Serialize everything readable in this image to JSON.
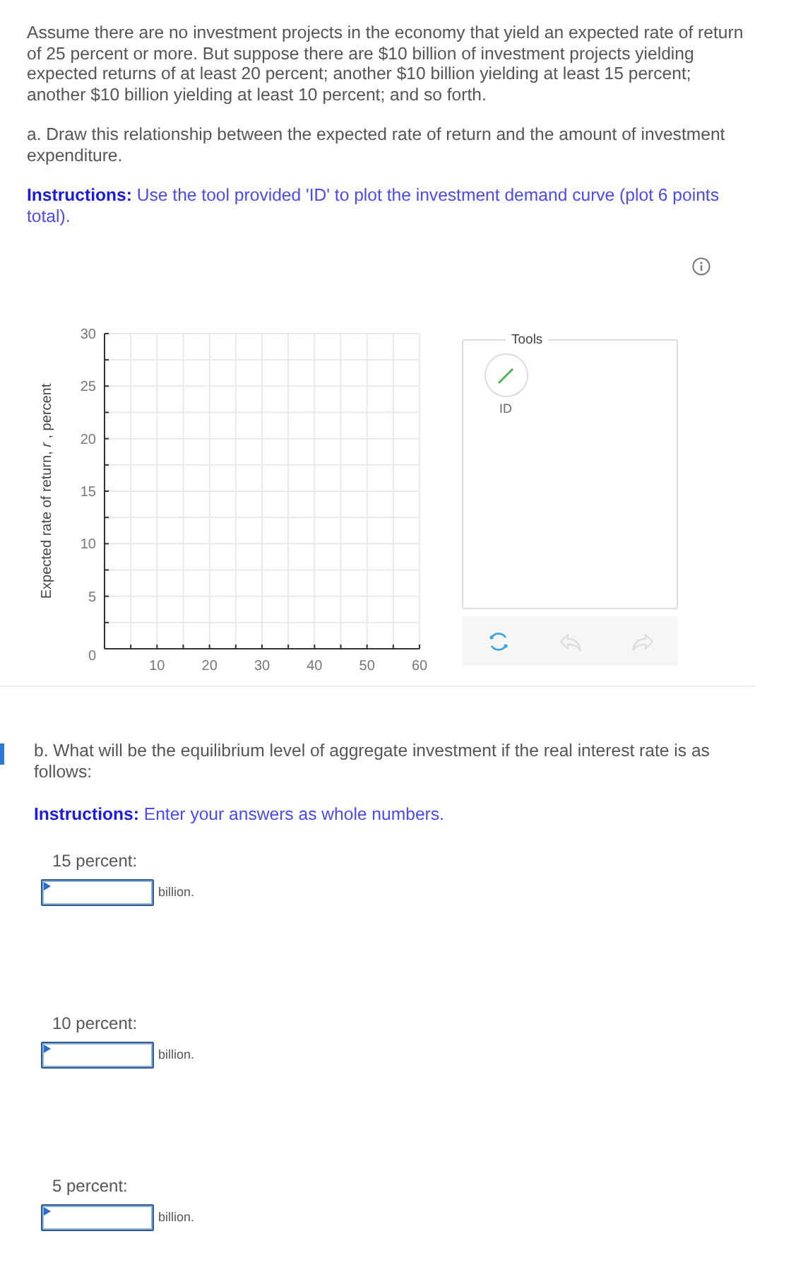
{
  "question": {
    "intro": "Assume there are no investment projects in the economy that yield an expected rate of return of 25 percent or more. But suppose there are $10 billion of investment projects yielding expected returns of at least 20 percent; another $10 billion yielding at least 15 percent; another $10 billion yielding at least 10 percent; and so forth.",
    "part_a": "a. Draw this relationship between the expected rate of return and the amount of investment expenditure.",
    "instructions_a": "**Instructions:** Use the tool provided 'ID' to plot the investment demand curve (plot 6 points total)."
  },
  "graph": {
    "chart_data": {
      "type": "scatter",
      "grid": true,
      "ylabel": "Expected rate of return, *r* , percent",
      "xlim": [
        0,
        60
      ],
      "ylim": [
        0,
        30
      ],
      "xticks": [
        10,
        20,
        30,
        40,
        50,
        60
      ],
      "yticks": [
        0,
        5,
        10,
        15,
        20,
        25,
        30
      ]
    },
    "tools": {
      "title": "Tools",
      "items": [
        {
          "label": "ID",
          "selected": false
        }
      ]
    },
    "toolbar": [
      {
        "kind": "reset",
        "disabled": false
      },
      {
        "kind": "undo",
        "disabled": true
      },
      {
        "kind": "redo",
        "disabled": true
      }
    ]
  },
  "part_b": {
    "question": "b. What will be the equilibrium level of aggregate investment if the real interest rate is as follows:",
    "instructions": "**Instructions:** Enter your answers as whole numbers.",
    "answers": [
      {
        "label": "15 percent:",
        "unit": "billion."
      },
      {
        "label": "10 percent:",
        "unit": "billion."
      },
      {
        "label": "5 percent:",
        "unit": "billion."
      }
    ]
  }
}
